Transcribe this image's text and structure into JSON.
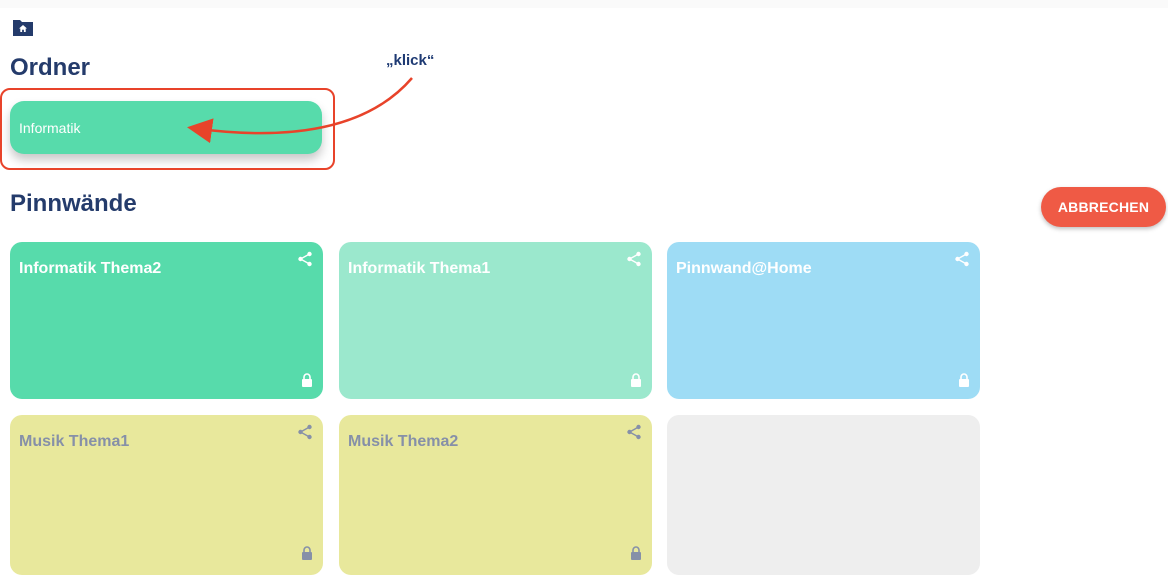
{
  "header": {
    "home_icon": "home-folder-icon"
  },
  "folders_section": {
    "title": "Ordner",
    "folders": [
      {
        "label": "Informatik",
        "color": "#57dbab"
      }
    ]
  },
  "annotation": {
    "label": "„klick“",
    "color": "#e8432a"
  },
  "boards_section": {
    "title": "Pinnwände",
    "cancel_label": "ABBRECHEN",
    "boards": [
      {
        "title": "Informatik Thema2",
        "color": "#57dbab",
        "icons": [
          "share-icon",
          "lock-icon"
        ]
      },
      {
        "title": "Informatik Thema1",
        "color": "#9be8cd",
        "icons": [
          "share-icon",
          "lock-icon"
        ]
      },
      {
        "title": "Pinnwand@Home",
        "color": "#9edcf5",
        "icons": [
          "share-icon",
          "lock-icon"
        ]
      },
      {
        "title": "Musik Thema1",
        "color": "#e8e89c",
        "icons": [
          "share-icon",
          "lock-icon"
        ]
      },
      {
        "title": "Musik Thema2",
        "color": "#e8e89c",
        "icons": [
          "share-icon",
          "lock-icon"
        ]
      },
      {
        "title": "",
        "color": "#eeeeee",
        "icons": []
      }
    ]
  }
}
